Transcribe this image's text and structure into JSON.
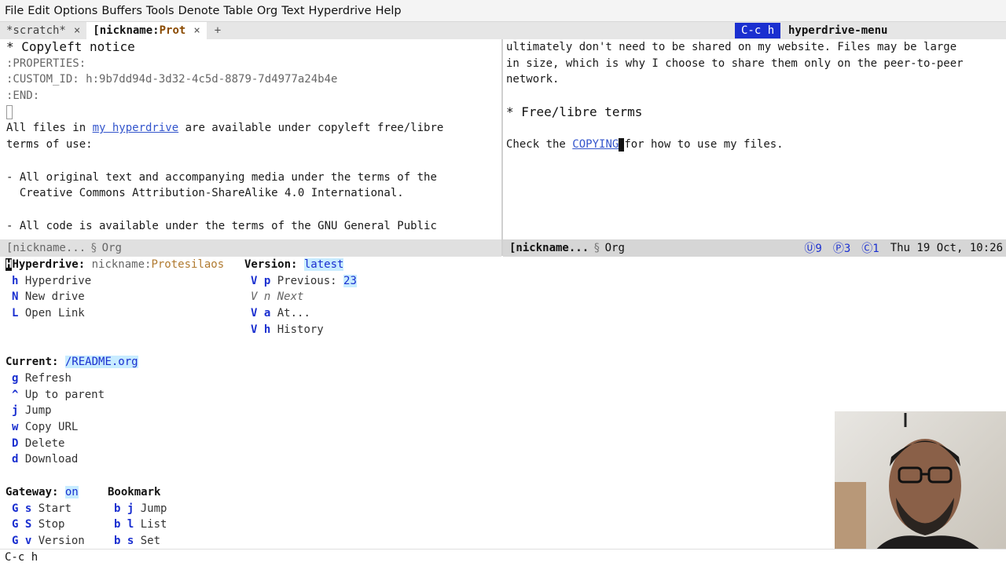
{
  "menubar": [
    "File",
    "Edit",
    "Options",
    "Buffers",
    "Tools",
    "Denote",
    "Table",
    "Org",
    "Text",
    "Hyperdrive",
    "Help"
  ],
  "tabs": [
    {
      "label": "*scratch*",
      "close": "×"
    },
    {
      "label_prefix": "[nickname:",
      "label_prot": "Prot",
      "close": "×"
    }
  ],
  "tab_add": "+",
  "keyhint": {
    "key": "C-c h",
    "command": "hyperdrive-menu"
  },
  "left_pane": {
    "heading": "* Copyleft notice",
    "properties": ":PROPERTIES:",
    "custom_id_key": ":CUSTOM_ID:",
    "custom_id_val": "h:9b7dd94d-3d32-4c5d-8879-7d4977a24b4e",
    "end": ":END:",
    "p1_a": "All files in ",
    "p1_link": "my hyperdrive",
    "p1_b": " are available under copyleft free/libre",
    "p1_c": "terms of use:",
    "b1_a": "- All original text and accompanying media under the terms of the",
    "b1_b": "  Creative Commons Attribution-ShareAlike 4.0 International.",
    "b2_a": "- All code is available under the terms of the GNU General Public"
  },
  "right_pane": {
    "l1": "ultimately don't need to be shared on my website. Files may be large",
    "l2": "in size, which is why I choose to share them only on the peer-to-peer",
    "l3": "network.",
    "heading": "* Free/libre terms",
    "c_a": "Check the ",
    "c_link": "COPYING",
    "c_b": "for how to use my files."
  },
  "modeline_left": {
    "buffer": "[nickname...",
    "sep": "§",
    "mode": "Org"
  },
  "modeline_right": {
    "buffer": "[nickname...",
    "sep": "§",
    "mode": "Org",
    "s1": "9",
    "s2": "3",
    "s3": "1",
    "clock": "Thu 19 Oct, 10:26"
  },
  "transient": {
    "title": "Hyperdrive:",
    "drive_prefix": "nickname:",
    "drive_name": "Protesilaos",
    "version_title": "Version:",
    "version_val": "latest",
    "drive_items": [
      {
        "key": "h",
        "desc": "Hyperdrive"
      },
      {
        "key": "N",
        "desc": "New drive"
      },
      {
        "key": "L",
        "desc": "Open Link"
      }
    ],
    "version_items": [
      {
        "key": "V p",
        "desc": "Previous:",
        "val": "23"
      },
      {
        "key": "V n",
        "desc": "Next"
      },
      {
        "key": "V a",
        "desc": "At..."
      },
      {
        "key": "V h",
        "desc": "History"
      }
    ],
    "current_title": "Current:",
    "current_val": "/README.org",
    "current_items": [
      {
        "key": "g",
        "desc": "Refresh"
      },
      {
        "key": "^",
        "desc": "Up to parent"
      },
      {
        "key": "j",
        "desc": "Jump"
      },
      {
        "key": "w",
        "desc": "Copy URL"
      },
      {
        "key": "D",
        "desc": "Delete"
      },
      {
        "key": "d",
        "desc": "Download"
      }
    ],
    "gateway_title": "Gateway:",
    "gateway_val": "on",
    "gateway_items": [
      {
        "key": "G s",
        "desc": "Start"
      },
      {
        "key": "G S",
        "desc": "Stop"
      },
      {
        "key": "G v",
        "desc": "Version"
      }
    ],
    "bookmark_title": "Bookmark",
    "bookmark_items": [
      {
        "key": "b j",
        "desc": "Jump"
      },
      {
        "key": "b l",
        "desc": "List"
      },
      {
        "key": "b s",
        "desc": "Set"
      }
    ]
  },
  "echo": "C-c h"
}
